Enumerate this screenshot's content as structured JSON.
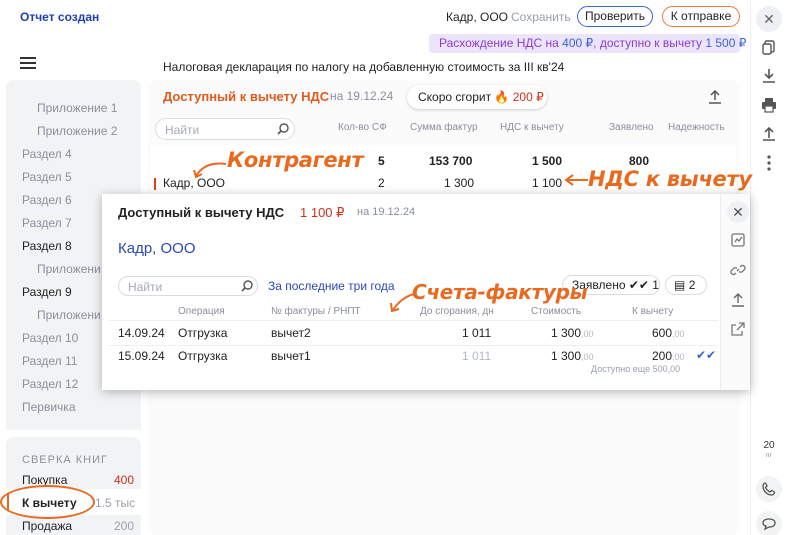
{
  "topbar": {
    "status": "Отчет создан",
    "company": "Кадр, ООО",
    "save_label": "Сохранить",
    "check_label": "Проверить",
    "send_label": "К отправке",
    "mismatch_prefix": "Расхождение НДС на",
    "mismatch_amount": "400 ₽",
    "mismatch_mid": ", доступно к вычету",
    "mismatch_available": "1 500 ₽"
  },
  "sidebar": {
    "items": [
      {
        "label": "Приложение 1"
      },
      {
        "label": "Приложение 2"
      },
      {
        "label": "Раздел 4"
      },
      {
        "label": "Раздел 5"
      },
      {
        "label": "Раздел 6"
      },
      {
        "label": "Раздел 7"
      },
      {
        "label": "Раздел 8"
      },
      {
        "label": "Приложени"
      },
      {
        "label": "Раздел 9"
      },
      {
        "label": "Приложени"
      },
      {
        "label": "Раздел 10"
      },
      {
        "label": "Раздел 11"
      },
      {
        "label": "Раздел 12"
      },
      {
        "label": "Первичка"
      }
    ],
    "books_title": "СВЕРКА КНИГ",
    "books": [
      {
        "label": "Покупка",
        "count": "400"
      },
      {
        "label": "К вычету",
        "count": "1.5 тыс"
      },
      {
        "label": "Продажа",
        "count": "200"
      }
    ]
  },
  "main": {
    "doc_title": "Налоговая декларация по налогу на добавленную стоимость за III кв'24",
    "card_title": "Доступный к вычету НДС",
    "card_date": "на 19.12.24",
    "expire_label": "Скоро сгорит",
    "expire_amount": "200 ₽",
    "search_placeholder": "Найти",
    "columns": [
      "Кол-во СФ",
      "Сумма фактур",
      "НДС к вычету",
      "Заявлено",
      "Надежность"
    ],
    "totals": {
      "count": "5",
      "sum": "153 700",
      "vat": "1 500",
      "declared": "800"
    },
    "rows": [
      {
        "company": "Кадр, ООО",
        "count": "2",
        "sum": "1 300",
        "vat": "1 100"
      }
    ]
  },
  "popup": {
    "title": "Доступный к вычету НДС",
    "amount": "1 100 ₽",
    "date": "на 19.12.24",
    "company": "Кадр, ООО",
    "search_placeholder": "Найти",
    "period": "За последние три года",
    "declared_label": "Заявлено",
    "declared_count": "1",
    "docs_count": "2",
    "columns": [
      "Операция",
      "№ фактуры / РНПТ",
      "До сгорания, дн",
      "Стоимость",
      "К вычету"
    ],
    "rows": [
      {
        "date": "14.09.24",
        "op": "Отгрузка",
        "invoice": "вычет2",
        "days": "1 011",
        "cost": "1 300",
        "cost_dec": ",00",
        "deduct": "600",
        "deduct_dec": ",00"
      },
      {
        "date": "15.09.24",
        "op": "Отгрузка",
        "invoice": "вычет1",
        "days": "1 011",
        "cost": "1 300",
        "cost_dec": ",00",
        "deduct": "200",
        "deduct_dec": ",00"
      }
    ],
    "remaining": "Доступно еще 500,00"
  },
  "annotations": {
    "counterparty": "Контрагент",
    "vat_deduct": "НДС к вычету",
    "invoices": "Счета-фактуры"
  },
  "rail": {
    "date_day": "20",
    "date_weekday": "пт"
  },
  "colors": {
    "accent_blue": "#2a49b8",
    "accent_orange": "#e86a1f",
    "alert_red": "#d0321a",
    "mismatch_bg": "#ece4fb"
  }
}
